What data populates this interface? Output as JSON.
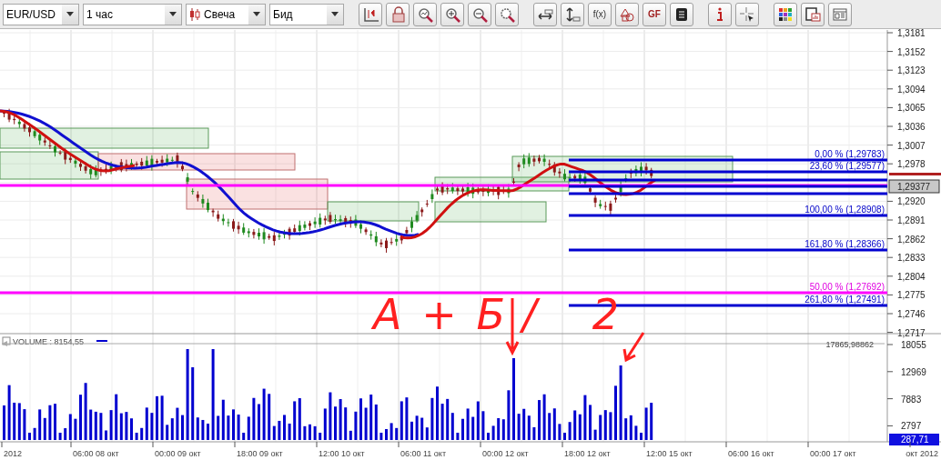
{
  "toolbar": {
    "selectors": [
      {
        "kind": "symbol",
        "value": "EUR/USD"
      },
      {
        "kind": "period",
        "value": "1 час"
      },
      {
        "kind": "chart_type",
        "value": "Свеча"
      },
      {
        "kind": "price",
        "value": "Бид"
      }
    ],
    "function_button": {
      "label": "f(x)"
    },
    "gf_button": {
      "label": "GF"
    }
  },
  "price_axis": {
    "labels": [
      "1,3181",
      "1,3152",
      "1,3123",
      "1,3094",
      "1,3065",
      "1,3036",
      "1,3007",
      "1,2978",
      "1,2920",
      "1,2891",
      "1,2862",
      "1,2833",
      "1,2804",
      "1,2775",
      "1,2746",
      "1,2717"
    ],
    "current_price": "1,29377"
  },
  "fibonacci": {
    "levels": [
      {
        "label": "0,00 % (1,29783)"
      },
      {
        "label": "23,60 % (1,29577)"
      },
      {
        "label": "100,00 % (1,28908)"
      },
      {
        "label": "161,80 % (1,28366)"
      },
      {
        "label": "261,80 % (1,27491)"
      }
    ]
  },
  "horizontal_line": {
    "label": "50,00 % (1,27692)"
  },
  "annotation": {
    "parts": [
      "A + Б",
      "/2"
    ]
  },
  "volume": {
    "legend": "VOLUME : 8154,55",
    "marker_value": "17865,98862",
    "axis_labels": [
      "18055",
      "12969",
      "7883",
      "2797"
    ],
    "current": "287,71"
  },
  "time_axis": {
    "labels": [
      "2012",
      "06:00 08 окт",
      "00:00 09 окт",
      "18:00 09 окт",
      "12:00 10 окт",
      "06:00 11 окт",
      "00:00 12 окт",
      "18:00 12 окт",
      "12:00 15 окт",
      "06:00 16 окт",
      "00:00 17 окт",
      "окт 2012"
    ]
  }
}
